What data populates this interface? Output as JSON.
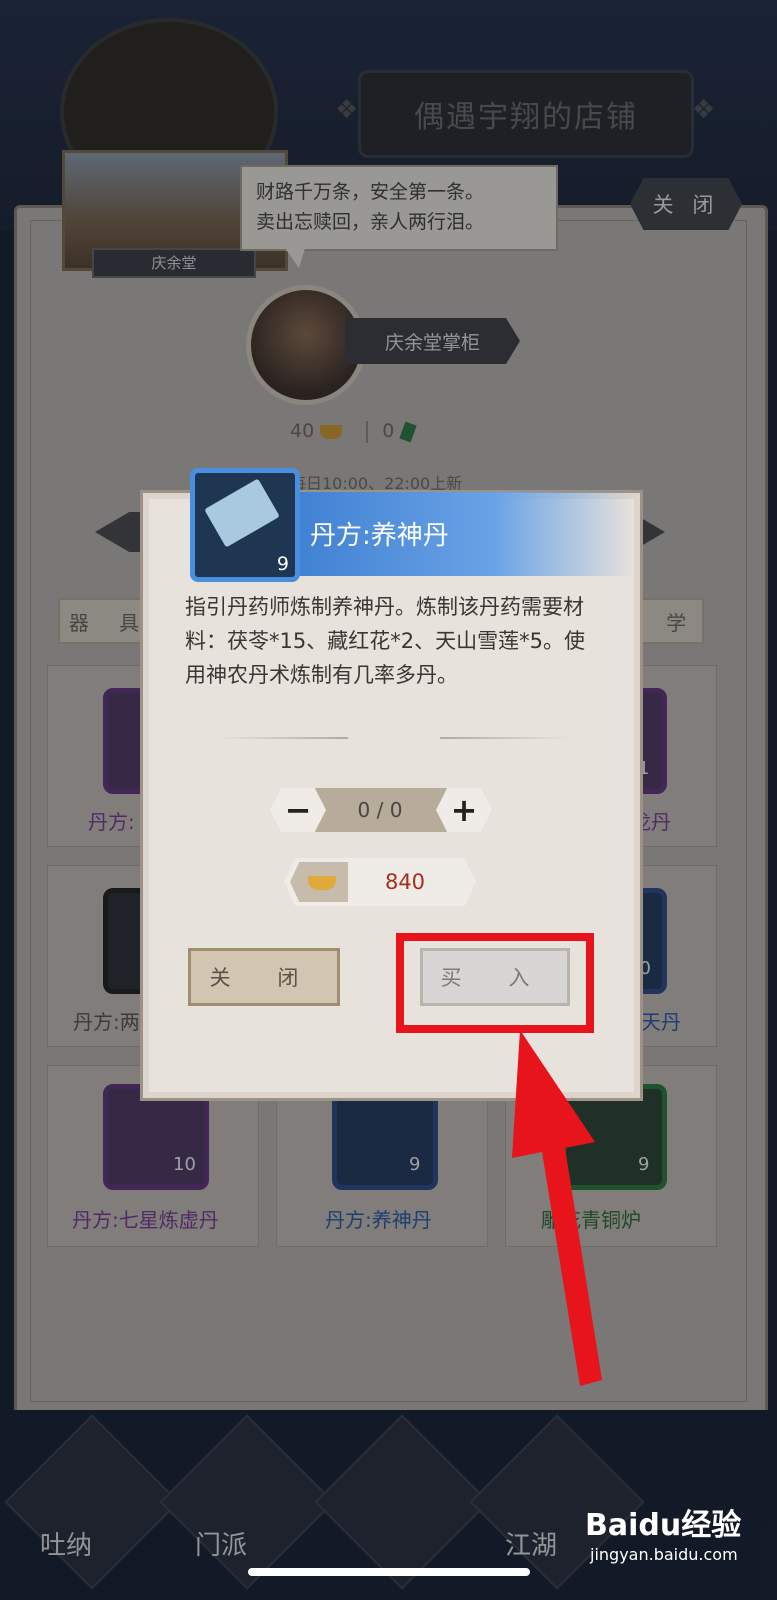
{
  "background": {
    "banner_text": "偶遇宇翔的店铺",
    "shop_name": "庆余堂",
    "speech": [
      "财路千万条，安全第一条。",
      "卖出忘赎回，亲人两行泪。"
    ],
    "close_label": "关 闭",
    "owner_title": "庆余堂掌柜",
    "currency_gold": "40",
    "currency_jade": "0",
    "refresh_text": "每日10:00、22:00上新",
    "category_left": "器 具",
    "category_right": "杂 学",
    "cards": [
      {
        "label": "丹方:",
        "count": "",
        "color": "#7a3a94"
      },
      {
        "label": "玄龙丹",
        "count": "1",
        "color": "#7a3a94"
      },
      {
        "label": "丹方:两",
        "count": "",
        "color": "#555"
      },
      {
        "label": "补天丹",
        "count": "10",
        "color": "#2b56a8"
      },
      {
        "label": "丹方:七星炼虚丹",
        "count": "10",
        "color": "#7a3a94"
      },
      {
        "label": "丹方:养神丹",
        "count": "9",
        "color": "#2b56a8"
      },
      {
        "label": "雕花青铜炉",
        "count": "9",
        "color": "#2b6a35"
      }
    ],
    "bottom_nav": [
      "吐纳",
      "门派",
      "",
      "江湖",
      ""
    ]
  },
  "modal": {
    "title": "丹方:养神丹",
    "item_count": "9",
    "description": "指引丹药师炼制养神丹。炼制该丹药需要材料：茯苓*15、藏红花*2、天山雪莲*5。使用神农丹术炼制有几率多丹。",
    "minus_label": "−",
    "plus_label": "+",
    "quantity_text": "0 / 0",
    "price": "840",
    "close_button": "关 闭",
    "buy_button": "买 入"
  },
  "watermark": {
    "text": "Baidu经验",
    "url": "jingyan.baidu.com"
  },
  "colors": {
    "highlight": "#e8141b",
    "title_blue": "#3e7fd2",
    "price_red": "#a3301e"
  }
}
